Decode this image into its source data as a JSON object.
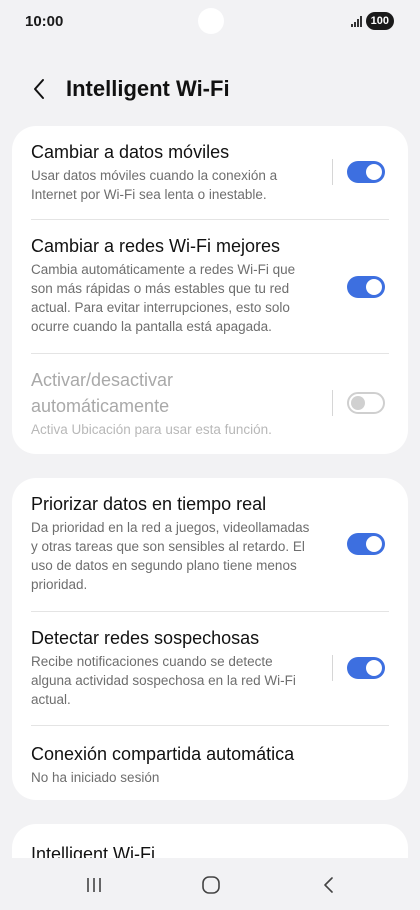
{
  "status_bar": {
    "time": "10:00",
    "battery": "100"
  },
  "header": {
    "title": "Intelligent Wi-Fi"
  },
  "settings": {
    "switch_to_mobile": {
      "title": "Cambiar a datos móviles",
      "line1": "Usar datos móviles cuando la conexión a",
      "line2": "Internet por Wi-Fi sea lenta o inestable.",
      "enabled": true
    },
    "switch_better_wifi": {
      "title": "Cambiar a redes Wi-Fi mejores",
      "line1": "Cambia automáticamente a redes Wi-Fi que",
      "line2": "son más rápidas o más estables que tu red",
      "line3": "actual. Para evitar interrupciones, esto solo",
      "line4": "ocurre cuando la pantalla está apagada.",
      "enabled": true
    },
    "auto_on_off": {
      "title_line1": "Activar/desactivar",
      "title_line2": "automáticamente",
      "line1": "Activa Ubicación para usar esta función.",
      "enabled": false
    },
    "prioritize_realtime": {
      "title": "Priorizar datos en tiempo real",
      "line1": "Da prioridad en la red a juegos, videollamadas",
      "line2": "y otras tareas que son sensibles al retardo. El",
      "line3": "uso de datos en segundo plano tiene menos",
      "line4": "prioridad.",
      "enabled": true
    },
    "detect_suspicious": {
      "title": "Detectar redes sospechosas",
      "line1": "Recibe notificaciones cuando se detecte",
      "line2": "alguna actividad sospechosa en la red Wi-Fi",
      "line3": "actual.",
      "enabled": true
    },
    "auto_hotspot": {
      "title": "Conexión compartida automática",
      "line1": "No ha iniciado sesión"
    },
    "intelligent_wifi_about": {
      "title": "Intelligent Wi-Fi"
    }
  },
  "colors": {
    "accent": "#3d6fe0",
    "background": "#f2f2f4",
    "card": "#ffffff"
  },
  "icons": {
    "back": "chevron-left-icon",
    "recents": "recents-icon",
    "home": "home-icon",
    "nav_back": "back-icon"
  }
}
